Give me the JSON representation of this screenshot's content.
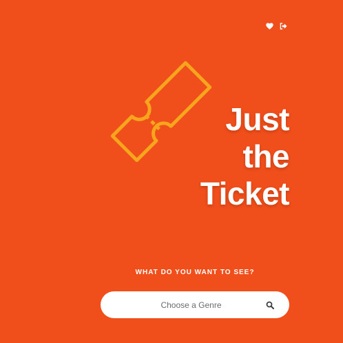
{
  "header": {
    "favorites_icon": "heart-icon",
    "logout_icon": "sign-out-icon"
  },
  "brand": {
    "logo_icon": "ticket-icon",
    "title_lines": [
      "Just",
      "the",
      "Ticket"
    ]
  },
  "search": {
    "prompt": "WHAT DO YOU WANT TO SEE?",
    "placeholder": "Choose a Genre",
    "icon": "search-icon"
  },
  "colors": {
    "background": "#f04f1b",
    "accent": "#f7a51d",
    "text": "#ffffff"
  }
}
